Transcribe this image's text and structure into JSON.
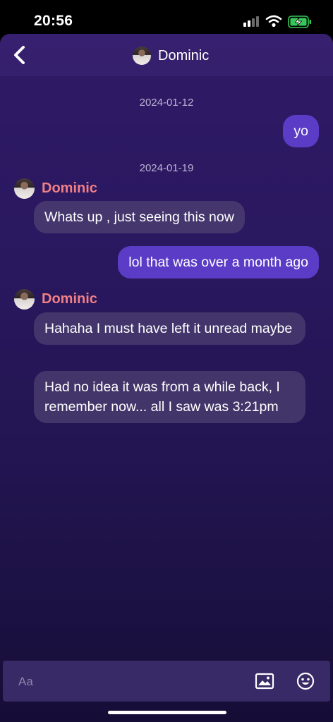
{
  "status_bar": {
    "time": "20:56",
    "signal_icon": "cellular-signal-icon",
    "wifi_icon": "wifi-icon",
    "battery_icon": "battery-charging-icon"
  },
  "header": {
    "contact_name": "Dominic",
    "back_icon": "chevron-left-icon"
  },
  "conversation": {
    "dates": [
      "2024-01-12",
      "2024-01-19"
    ],
    "messages": [
      {
        "direction": "out",
        "text": "yo"
      },
      {
        "direction": "in",
        "sender": "Dominic",
        "text": "Whats up , just seeing this now"
      },
      {
        "direction": "out",
        "text": "lol that was over a month ago"
      },
      {
        "direction": "in",
        "sender": "Dominic",
        "text": "Hahaha I must have left it unread maybe"
      },
      {
        "direction": "in",
        "text": "Had no idea it was from a while back, I remember now... all I saw was 3:21pm"
      }
    ]
  },
  "composer": {
    "placeholder": "Aa",
    "image_icon": "image-icon",
    "emoji_icon": "emoji-icon"
  },
  "colors": {
    "outgoing_bubble": "#5b3cc6",
    "incoming_bubble": "#4f4370",
    "sender_name": "#f07f86",
    "background": "#2a1860"
  }
}
